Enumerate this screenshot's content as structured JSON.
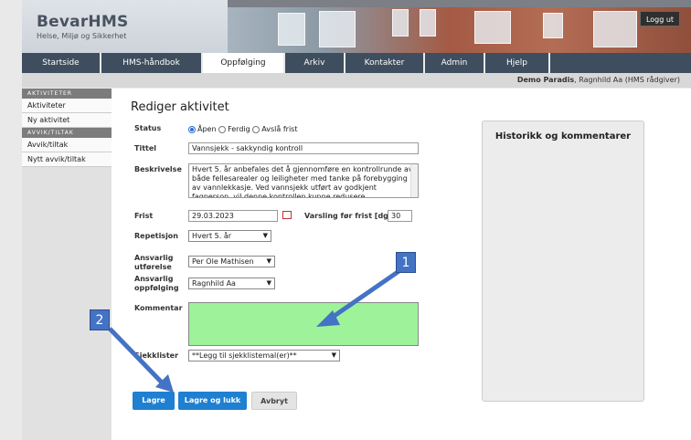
{
  "header": {
    "brand": "BevarHMS",
    "tagline": "Helse, Miljø og Sikkerhet",
    "logout_label": "Logg ut"
  },
  "nav": {
    "tabs": [
      {
        "label": "Startside"
      },
      {
        "label": "HMS-håndbok"
      },
      {
        "label": "Oppfølging",
        "active": true
      },
      {
        "label": "Arkiv"
      },
      {
        "label": "Kontakter"
      },
      {
        "label": "Admin"
      },
      {
        "label": "Hjelp"
      }
    ]
  },
  "userbar": {
    "company": "Demo Paradis",
    "user": ", Ragnhild Aa (HMS rådgiver)"
  },
  "sidebar": {
    "sections": [
      {
        "header": "AKTIVITETER",
        "items": [
          "Aktiviteter",
          "Ny aktivitet"
        ]
      },
      {
        "header": "AVVIK/TILTAK",
        "items": [
          "Avvik/tiltak",
          "Nytt avvik/tiltak"
        ]
      }
    ]
  },
  "form": {
    "title": "Rediger aktivitet",
    "status_label": "Status",
    "status_options": [
      "Åpen",
      "Ferdig",
      "Avslå frist"
    ],
    "status_selected": "Åpen",
    "tittel_label": "Tittel",
    "tittel_value": "Vannsjekk - sakkyndig kontroll",
    "beskrivelse_label": "Beskrivelse",
    "beskrivelse_value": "Hvert 5. år anbefales det å gjennomføre en kontrollrunde av både fellesarealer og leiligheter med tanke på forebygging av vannlekkasje. Ved vannsjekk utført av godkjent fagperson, vil denne kontrollen kunne redusere forsikringspremien til",
    "frist_label": "Frist",
    "frist_value": "29.03.2023",
    "varsling_label": "Varsling før frist [dg]",
    "varsling_value": "30",
    "repetisjon_label": "Repetisjon",
    "repetisjon_value": "Hvert 5. år",
    "ansvarlig_utforelse_label": "Ansvarlig utførelse",
    "ansvarlig_utforelse_value": "Per Ole Mathisen",
    "ansvarlig_oppfolging_label": "Ansvarlig oppfølging",
    "ansvarlig_oppfolging_value": "Ragnhild Aa",
    "kommentar_label": "Kommentar",
    "kommentar_value": "",
    "sjekklister_label": "Sjekklister",
    "sjekklister_value": "**Legg til sjekklistemal(er)**"
  },
  "buttons": {
    "lagre": "Lagre",
    "lagre_og_lukk": "Lagre og lukk",
    "avbryt": "Avbryt"
  },
  "history": {
    "title": "Historikk og kommentarer"
  },
  "callouts": {
    "one": "1",
    "two": "2",
    "color": "#4472c4"
  }
}
